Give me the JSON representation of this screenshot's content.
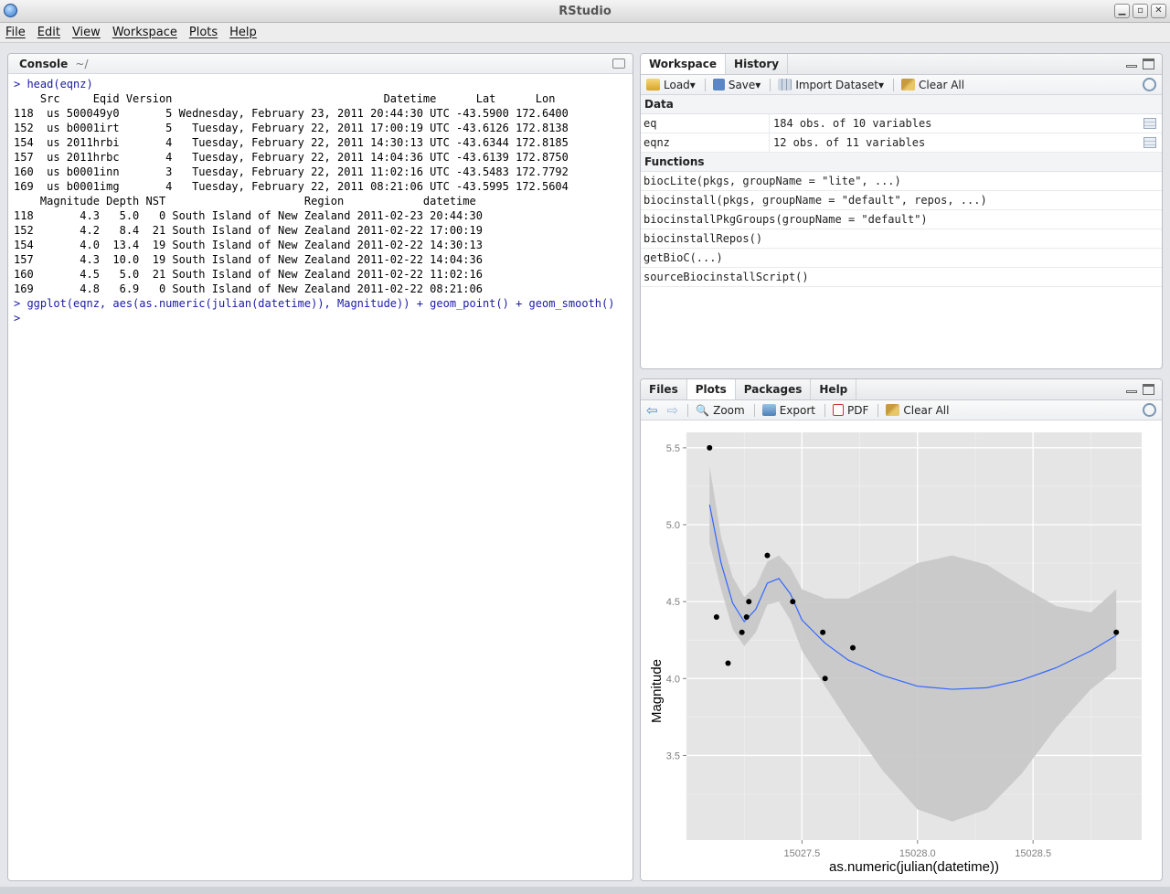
{
  "window": {
    "title": "RStudio"
  },
  "menu": [
    "File",
    "Edit",
    "View",
    "Workspace",
    "Plots",
    "Help"
  ],
  "console": {
    "title": "Console",
    "path": "~/",
    "lines": [
      {
        "t": "> head(eqnz)",
        "cmd": true
      },
      {
        "t": "    Src     Eqid Version                                Datetime      Lat      Lon",
        "cmd": false
      },
      {
        "t": "118  us 500049y0       5 Wednesday, February 23, 2011 20:44:30 UTC -43.5900 172.6400",
        "cmd": false
      },
      {
        "t": "152  us b0001irt       5   Tuesday, February 22, 2011 17:00:19 UTC -43.6126 172.8138",
        "cmd": false
      },
      {
        "t": "154  us 2011hrbi       4   Tuesday, February 22, 2011 14:30:13 UTC -43.6344 172.8185",
        "cmd": false
      },
      {
        "t": "157  us 2011hrbc       4   Tuesday, February 22, 2011 14:04:36 UTC -43.6139 172.8750",
        "cmd": false
      },
      {
        "t": "160  us b0001inn       3   Tuesday, February 22, 2011 11:02:16 UTC -43.5483 172.7792",
        "cmd": false
      },
      {
        "t": "169  us b0001img       4   Tuesday, February 22, 2011 08:21:06 UTC -43.5995 172.5604",
        "cmd": false
      },
      {
        "t": "    Magnitude Depth NST                     Region            datetime",
        "cmd": false
      },
      {
        "t": "118       4.3   5.0   0 South Island of New Zealand 2011-02-23 20:44:30",
        "cmd": false
      },
      {
        "t": "152       4.2   8.4  21 South Island of New Zealand 2011-02-22 17:00:19",
        "cmd": false
      },
      {
        "t": "154       4.0  13.4  19 South Island of New Zealand 2011-02-22 14:30:13",
        "cmd": false
      },
      {
        "t": "157       4.3  10.0  19 South Island of New Zealand 2011-02-22 14:04:36",
        "cmd": false
      },
      {
        "t": "160       4.5   5.0  21 South Island of New Zealand 2011-02-22 11:02:16",
        "cmd": false
      },
      {
        "t": "169       4.8   6.9   0 South Island of New Zealand 2011-02-22 08:21:06",
        "cmd": false
      },
      {
        "t": "> ggplot(eqnz, aes(as.numeric(julian(datetime)), Magnitude)) + geom_point() + geom_smooth()",
        "cmd": true
      },
      {
        "t": ">",
        "cmd": true
      }
    ]
  },
  "workspace": {
    "tabs": [
      "Workspace",
      "History"
    ],
    "toolbar": {
      "load": "Load",
      "save": "Save",
      "import": "Import Dataset",
      "clear": "Clear All"
    },
    "data_heading": "Data",
    "data": [
      {
        "name": "eq",
        "value": "184 obs. of 10 variables"
      },
      {
        "name": "eqnz",
        "value": "12 obs. of 11 variables"
      }
    ],
    "functions_heading": "Functions",
    "functions": [
      "biocLite(pkgs, groupName = \"lite\", ...)",
      "biocinstall(pkgs, groupName = \"default\", repos, ...)",
      "biocinstallPkgGroups(groupName = \"default\")",
      "biocinstallRepos()",
      "getBioC(...)",
      "sourceBiocinstallScript()"
    ]
  },
  "files": {
    "tabs": [
      "Files",
      "Plots",
      "Packages",
      "Help"
    ],
    "toolbar": {
      "zoom": "Zoom",
      "export": "Export",
      "pdf": "PDF",
      "clear": "Clear All"
    }
  },
  "colors": {
    "panel_bg": "#e5e5e5",
    "smooth_line": "#3366ff",
    "ribbon": "#c7c7c7",
    "point": "#000000"
  },
  "chart_data": {
    "type": "scatter",
    "xlabel": "as.numeric(julian(datetime))",
    "ylabel": "Magnitude",
    "xlim": [
      15027.0,
      15028.97
    ],
    "ylim": [
      2.95,
      5.6
    ],
    "xticks": [
      15027.5,
      15028.0,
      15028.5
    ],
    "xtick_labels": [
      "15027.5",
      "15028.0",
      "15028.5"
    ],
    "yticks": [
      3.5,
      4.0,
      4.5,
      5.0,
      5.5
    ],
    "ytick_labels": [
      "3.5",
      "4.0",
      "4.5",
      "5.0",
      "5.5"
    ],
    "grid": true,
    "points": [
      {
        "x": 15027.1,
        "y": 5.5
      },
      {
        "x": 15027.13,
        "y": 4.4
      },
      {
        "x": 15027.18,
        "y": 4.1
      },
      {
        "x": 15027.24,
        "y": 4.3
      },
      {
        "x": 15027.26,
        "y": 4.4
      },
      {
        "x": 15027.27,
        "y": 4.5
      },
      {
        "x": 15027.35,
        "y": 4.8
      },
      {
        "x": 15027.46,
        "y": 4.5
      },
      {
        "x": 15027.59,
        "y": 4.3
      },
      {
        "x": 15027.6,
        "y": 4.0
      },
      {
        "x": 15027.72,
        "y": 4.2
      },
      {
        "x": 15028.86,
        "y": 4.3
      }
    ],
    "smooth": {
      "x": [
        15027.1,
        15027.15,
        15027.2,
        15027.25,
        15027.3,
        15027.35,
        15027.4,
        15027.45,
        15027.5,
        15027.6,
        15027.7,
        15027.85,
        15028.0,
        15028.15,
        15028.3,
        15028.45,
        15028.6,
        15028.75,
        15028.86
      ],
      "y": [
        5.13,
        4.75,
        4.49,
        4.37,
        4.45,
        4.62,
        4.65,
        4.55,
        4.38,
        4.23,
        4.12,
        4.02,
        3.95,
        3.93,
        3.94,
        3.99,
        4.07,
        4.18,
        4.28
      ],
      "lower": [
        4.88,
        4.58,
        4.32,
        4.21,
        4.3,
        4.48,
        4.5,
        4.38,
        4.18,
        3.95,
        3.72,
        3.4,
        3.15,
        3.07,
        3.15,
        3.38,
        3.68,
        3.93,
        4.06
      ],
      "upper": [
        5.38,
        4.92,
        4.66,
        4.53,
        4.6,
        4.76,
        4.8,
        4.72,
        4.58,
        4.52,
        4.52,
        4.63,
        4.75,
        4.8,
        4.74,
        4.6,
        4.47,
        4.43,
        4.58
      ]
    }
  }
}
